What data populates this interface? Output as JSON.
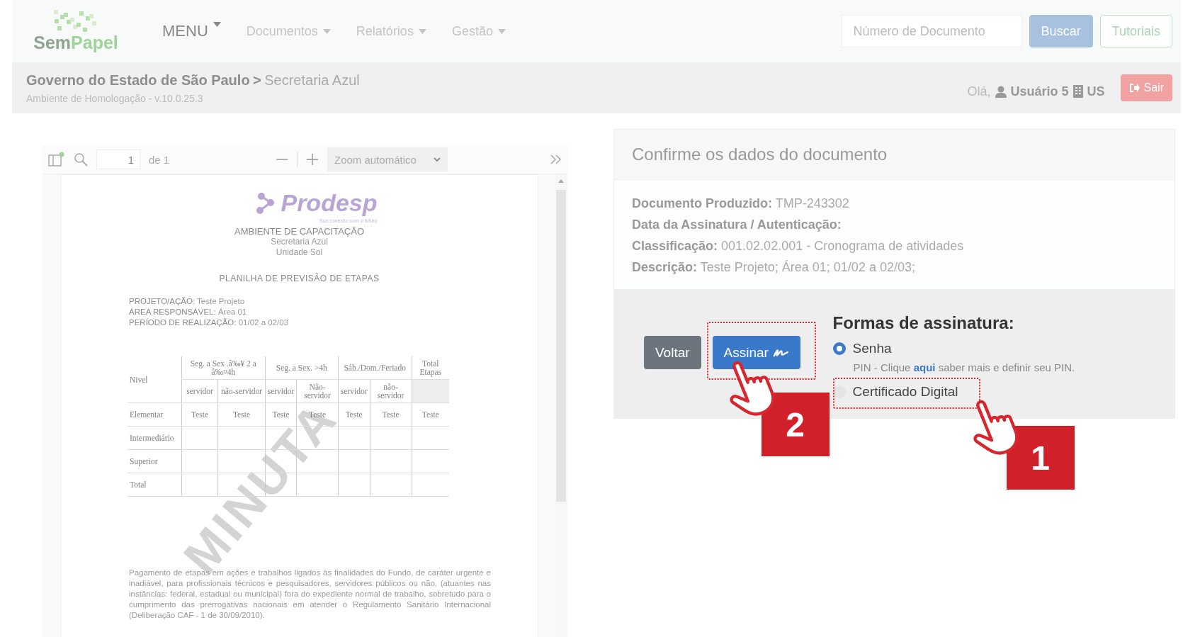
{
  "nav": {
    "logo": {
      "first": "Sem",
      "second": "Papel"
    },
    "menus": [
      {
        "label": "MENU",
        "kind": "main"
      },
      {
        "label": "Documentos",
        "kind": "sub"
      },
      {
        "label": "Relatórios",
        "kind": "sub"
      },
      {
        "label": "Gestão",
        "kind": "sub"
      }
    ],
    "search": {
      "placeholder": "Número de Documento"
    },
    "buttons": [
      {
        "label": "Buscar",
        "kind": "primary"
      },
      {
        "label": "Tutoriais",
        "kind": "outline"
      }
    ]
  },
  "breadcrumb": {
    "org": "Governo do Estado de São Paulo",
    "separator": ">",
    "unit": "Secretaria Azul",
    "environment": "Ambiente de Homologação - v.10.0.25.3"
  },
  "user": {
    "greeting": "Olá,",
    "name": "Usuário 5",
    "unit": "US",
    "logout": "Sair"
  },
  "viewer": {
    "page": "1",
    "page_count": "de 1",
    "zoom": "Zoom automático",
    "document": {
      "brand": "Prodesp",
      "tagline": "Sua conexão com o futuro",
      "heading": [
        "AMBIENTE DE CAPACITAÇÃO",
        "Secretaria Azul",
        "Unidade Sol"
      ],
      "title": "PLANILHA DE PREVISÃO DE ETAPAS",
      "info": [
        {
          "label": "PROJETO/AÇÃO:",
          "value": "Teste Projeto"
        },
        {
          "label": "ÁREA RESPONSÁVEL:",
          "value": "Área 01"
        },
        {
          "label": "PERÍODO DE REALIZAÇÃO:",
          "value": "01/02 a 02/03"
        }
      ],
      "table": {
        "first_column": "Nivel",
        "groups": [
          {
            "label": "Seg. a Sex .â‰¥ 2 a â‰¤4h",
            "subcolumns": [
              "servidor",
              "não-servidor"
            ]
          },
          {
            "label": "Seg. a Sex. >4h",
            "subcolumns": [
              "servidor",
              "Não-servidor"
            ]
          },
          {
            "label": "Sáb./Dom./Feriado",
            "subcolumns": [
              "servidor",
              "não-servidor"
            ]
          },
          {
            "label": "Total Etapas"
          }
        ],
        "rows": [
          {
            "label": "Elementar",
            "cells": [
              "Teste",
              "Teste",
              "Teste",
              "Teste",
              "Teste",
              "Teste",
              "Teste"
            ]
          },
          {
            "label": "Intermediário"
          },
          {
            "label": "Superior"
          },
          {
            "label": "Total"
          }
        ]
      },
      "paragraph": "Pagamento de etapas em ações e trabalhos ligados às finalidades do Fundo, de caráter urgente e inadiável, para profissionais técnicos e pesquisadores, servidores públicos ou não, (atuantes nas instâncias: federal, estadual ou municipal) fora do expediente normal de trabalho, sobretudo para o cumprimento das prerrogativas nacionais em atender o Regulamento Sanitário Internacional (Deliberação CAF - 1 de 30/09/2010).",
      "watermark": "MINUTA"
    }
  },
  "confirm": {
    "title": "Confirme os dados do documento",
    "fields": [
      {
        "label": "Documento Produzido:",
        "value": "TMP-243302"
      },
      {
        "label": "Data da Assinatura / Autenticação:"
      },
      {
        "label": "Classificação:",
        "value": "001.02.02.001 - Cronograma de atividades"
      },
      {
        "label": "Descrição:",
        "value": "Teste Projeto; Área 01; 01/02 a 02/03;"
      }
    ],
    "buttons": [
      {
        "label": "Voltar",
        "kind": "secondary"
      },
      {
        "label": "Assinar",
        "kind": "sign",
        "step": "2"
      }
    ],
    "signature": {
      "title": "Formas de assinatura:",
      "options": [
        {
          "label": "Senha",
          "selected": true,
          "hint": {
            "before": "PIN - Clique",
            "link": "aqui",
            "after": "saber mais e definir seu PIN."
          }
        },
        {
          "label": "Certificado Digital",
          "selected": false,
          "step": "1"
        }
      ]
    }
  }
}
